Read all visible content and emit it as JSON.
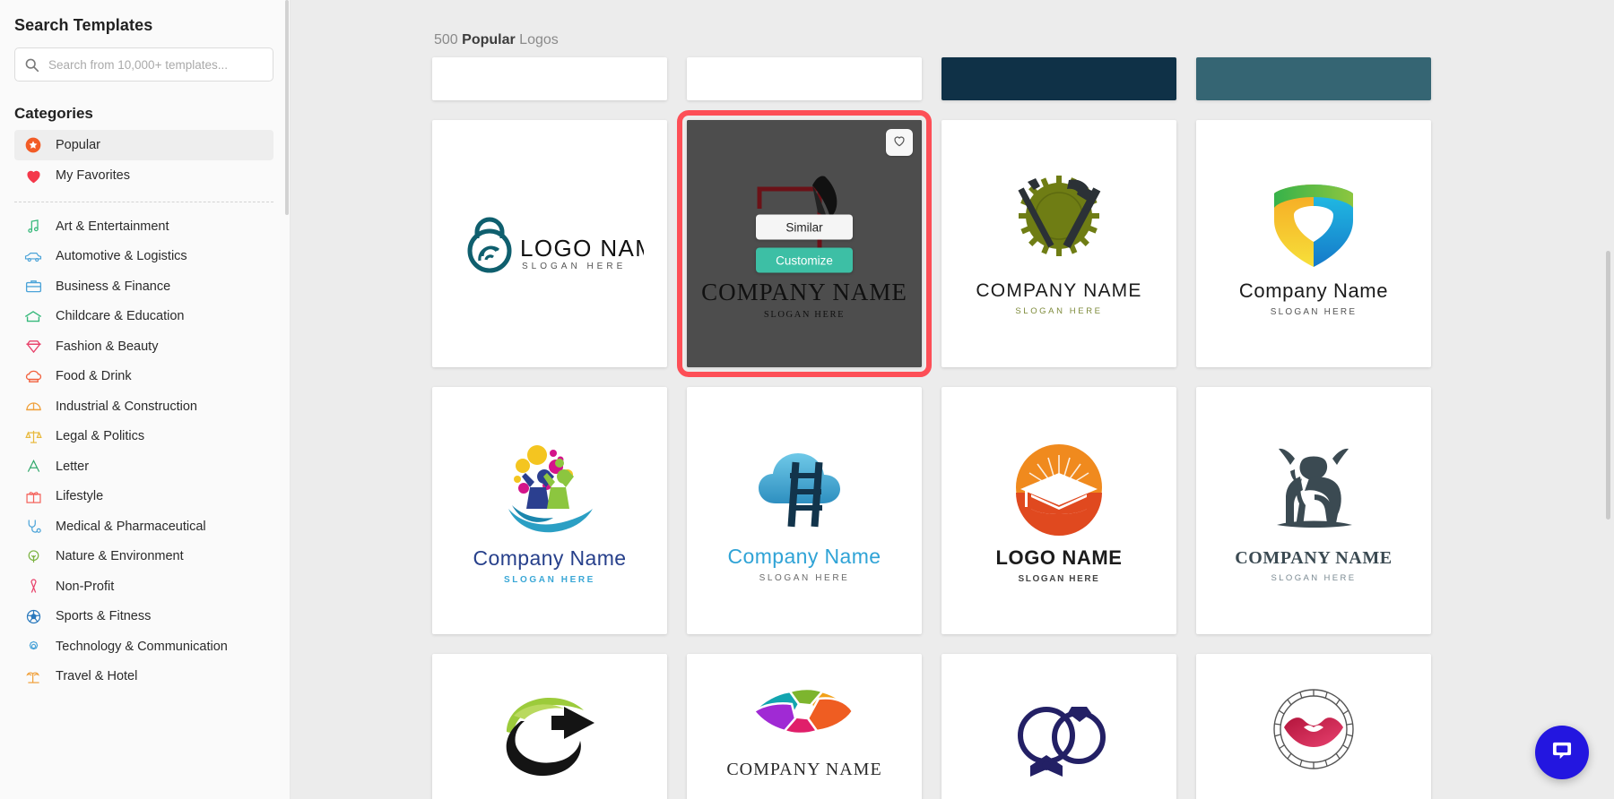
{
  "sidebar": {
    "title": "Search Templates",
    "search": {
      "placeholder": "Search from 10,000+ templates...",
      "value": "",
      "icon": "search-icon"
    },
    "categories_title": "Categories",
    "pinned": [
      {
        "label": "Popular",
        "icon": "star-badge-icon",
        "color": "#f25c26",
        "active": true
      },
      {
        "label": "My Favorites",
        "icon": "heart-icon",
        "color": "#f4384a",
        "active": false
      }
    ],
    "items": [
      {
        "label": "Art & Entertainment",
        "icon": "music-note-icon",
        "color": "#35b87a"
      },
      {
        "label": "Automotive & Logistics",
        "icon": "car-icon",
        "color": "#4ba3d8"
      },
      {
        "label": "Business & Finance",
        "icon": "briefcase-icon",
        "color": "#4ba3d8"
      },
      {
        "label": "Childcare & Education",
        "icon": "school-house-icon",
        "color": "#35b87a"
      },
      {
        "label": "Fashion & Beauty",
        "icon": "diamond-icon",
        "color": "#e8426b"
      },
      {
        "label": "Food & Drink",
        "icon": "chef-hat-icon",
        "color": "#f2603c"
      },
      {
        "label": "Industrial & Construction",
        "icon": "hard-hat-icon",
        "color": "#f0a13c"
      },
      {
        "label": "Legal & Politics",
        "icon": "scales-icon",
        "color": "#e8b93c"
      },
      {
        "label": "Letter",
        "icon": "letter-a-icon",
        "color": "#2fa86b"
      },
      {
        "label": "Lifestyle",
        "icon": "gift-icon",
        "color": "#f4615a"
      },
      {
        "label": "Medical & Pharmaceutical",
        "icon": "stethoscope-icon",
        "color": "#4ba3d8"
      },
      {
        "label": "Nature & Environment",
        "icon": "tree-icon",
        "color": "#7cb342"
      },
      {
        "label": "Non-Profit",
        "icon": "ribbon-icon",
        "color": "#e8426b"
      },
      {
        "label": "Sports & Fitness",
        "icon": "soccer-ball-icon",
        "color": "#2a79bd"
      },
      {
        "label": "Technology & Communication",
        "icon": "tech-hex-icon",
        "color": "#4ba3d8"
      },
      {
        "label": "Travel & Hotel",
        "icon": "palm-tree-icon",
        "color": "#f0a13c"
      }
    ]
  },
  "main": {
    "heading": {
      "count": "500",
      "strong": "Popular",
      "suffix": "Logos"
    },
    "selected_card": {
      "title": "COMPANY NAME",
      "slogan": "SLOGAN HERE",
      "similar_label": "Similar",
      "customize_label": "Customize",
      "favorite_icon": "heart-outline-icon",
      "overlay_color": "#4d4d4d",
      "highlight_color": "#fd4f57",
      "customize_color": "#3dbfa5"
    },
    "cards": [
      {
        "name": "lock-fingerprint-logo",
        "title": "LOGO NAME",
        "slogan": "SLOGAN HERE",
        "art": "lock-fingerprint",
        "color": "#0f5f6e"
      },
      {
        "name": "quill-company-logo",
        "title": "COMPANY NAME",
        "slogan": "SLOGAN HERE",
        "art": "quill",
        "color": "#6b1218"
      },
      {
        "name": "hammer-saw-logo",
        "title": "COMPANY NAME",
        "slogan": "SLOGAN HERE",
        "art": "hammer-saw",
        "color": "#6f7d14"
      },
      {
        "name": "shield-gradient-logo",
        "title": "Company  Name",
        "slogan": "SLOGAN HERE",
        "art": "shield",
        "color": "#2fb44c"
      },
      {
        "name": "people-hand-logo",
        "title": "Company Name",
        "slogan": "SLOGAN HERE",
        "art": "people-hand",
        "color": "#27408b"
      },
      {
        "name": "cloud-ladder-logo",
        "title": "Company Name",
        "slogan": "SLOGAN HERE",
        "art": "cloud-ladder",
        "color": "#2fa3d6"
      },
      {
        "name": "sunrise-graduation-logo",
        "title": "LOGO NAME",
        "slogan": "SLOGAN HERE",
        "art": "sunrise-cap",
        "color": "#f08a1e"
      },
      {
        "name": "bull-logo",
        "title": "COMPANY NAME",
        "slogan": "SLOGAN HERE",
        "art": "bull",
        "color": "#3b4a52"
      },
      {
        "name": "arrow-swoosh-logo",
        "title": "",
        "slogan": "",
        "art": "arrow-swoosh",
        "color": "#9ccb3b"
      },
      {
        "name": "camera-shutter-logo",
        "title": "COMPANY NAME",
        "slogan": "",
        "art": "shutter",
        "color": "#e8552d"
      },
      {
        "name": "wedding-rings-logo",
        "title": "",
        "slogan": "",
        "art": "rings-bowtie",
        "color": "#232065"
      },
      {
        "name": "lips-circle-logo",
        "title": "",
        "slogan": "",
        "art": "lips",
        "color": "#d8254f"
      }
    ],
    "chat_button": {
      "icon": "chat-bubble-icon",
      "color": "#2316e0"
    }
  }
}
